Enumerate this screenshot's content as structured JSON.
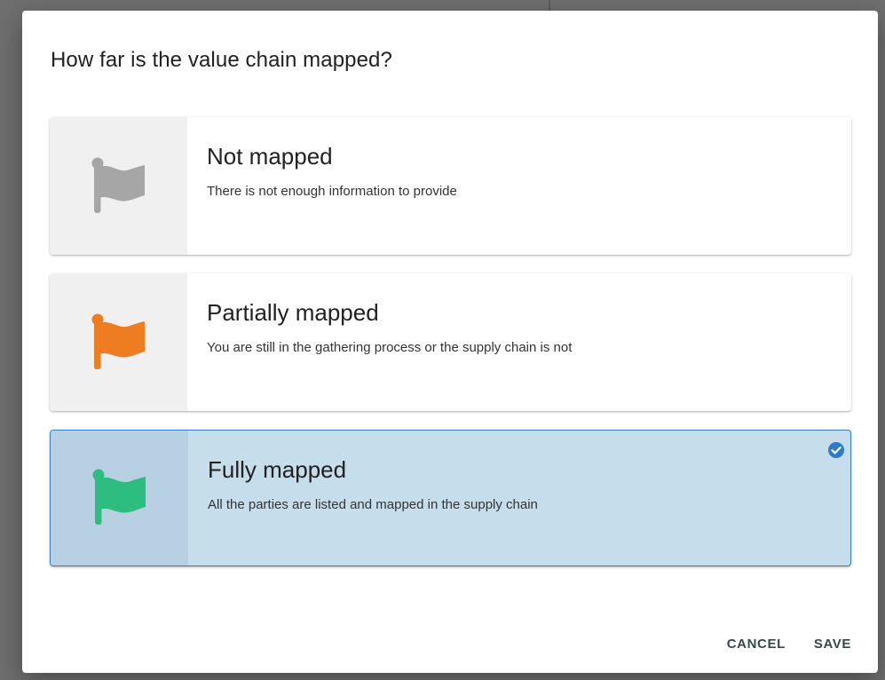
{
  "dialog": {
    "title": "How far is the value chain mapped?",
    "options": [
      {
        "title": "Not mapped",
        "description": "There is not enough information to provide",
        "icon": "flag-icon",
        "icon_color": "#a6a6a6",
        "selected": false
      },
      {
        "title": "Partially mapped",
        "description": "You are still in the gathering process or the supply chain is not",
        "icon": "flag-icon",
        "icon_color": "#ee7d22",
        "selected": false
      },
      {
        "title": "Fully mapped",
        "description": "All the parties are listed and mapped in the supply chain",
        "icon": "flag-icon",
        "icon_color": "#2ebd81",
        "selected": true
      }
    ],
    "selected_indicator_icon": "check-circle-icon",
    "selected_indicator_color": "#2f7cc5",
    "selected_background": "#c6ddec",
    "actions": {
      "cancel_label": "CANCEL",
      "save_label": "SAVE"
    }
  }
}
